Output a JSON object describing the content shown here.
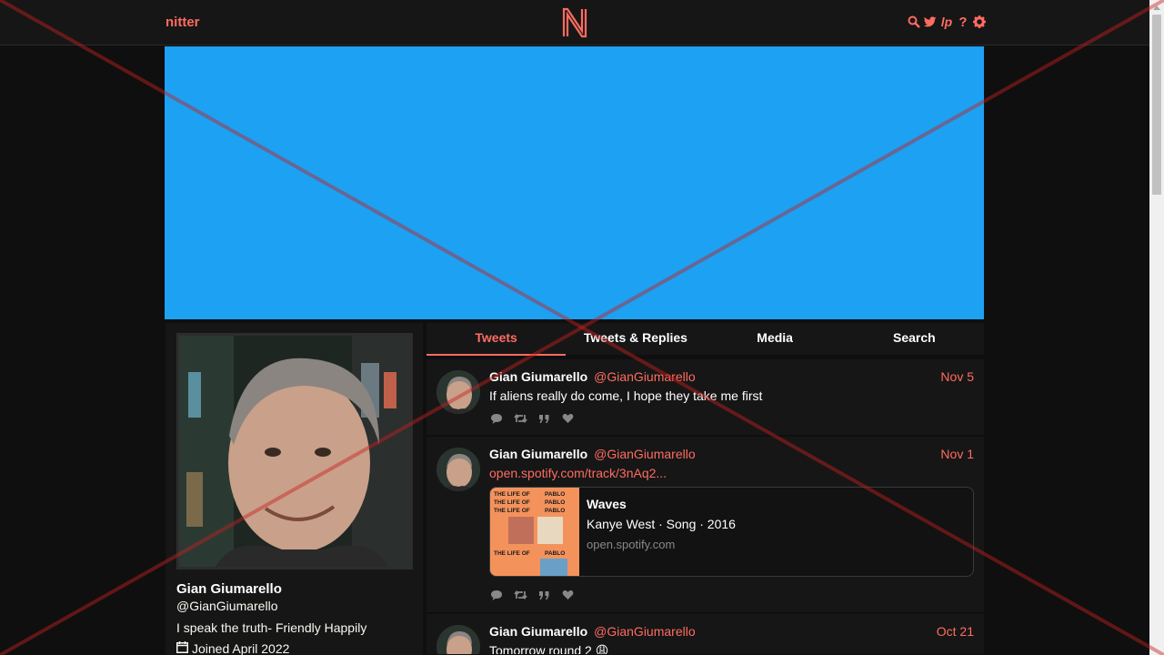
{
  "nav": {
    "brand": "nitter",
    "logo_letter": "N",
    "icons": [
      "search-icon",
      "twitter-icon",
      "lp-icon",
      "help-icon",
      "gear-icon"
    ],
    "lp_label": "lp",
    "help_label": "?"
  },
  "colors": {
    "accent": "#ff6c60",
    "banner": "#1da1f2",
    "background": "#0f0f0f",
    "panel": "#161616"
  },
  "profile": {
    "name": "Gian Giumarello",
    "handle": "@GianGiumarello",
    "bio": "I speak the truth- Friendly Happily",
    "joined": "Joined April 2022"
  },
  "tabs": [
    {
      "label": "Tweets",
      "active": true
    },
    {
      "label": "Tweets & Replies",
      "active": false
    },
    {
      "label": "Media",
      "active": false
    },
    {
      "label": "Search",
      "active": false
    }
  ],
  "tweets": [
    {
      "name": "Gian Giumarello",
      "handle": "@GianGiumarello",
      "date": "Nov 5",
      "text": "If aliens really do come, I hope they take me first"
    },
    {
      "name": "Gian Giumarello",
      "handle": "@GianGiumarello",
      "date": "Nov 1",
      "link": "open.spotify.com/track/3nAq2...",
      "card": {
        "image_lines": [
          "THE LIFE OF",
          "PABLO"
        ],
        "title": "Waves",
        "description": "Kanye West · Song · 2016",
        "destination": "open.spotify.com"
      }
    },
    {
      "name": "Gian Giumarello",
      "handle": "@GianGiumarello",
      "date": "Oct 21",
      "text": "Tomorrow round 2 😩"
    }
  ]
}
